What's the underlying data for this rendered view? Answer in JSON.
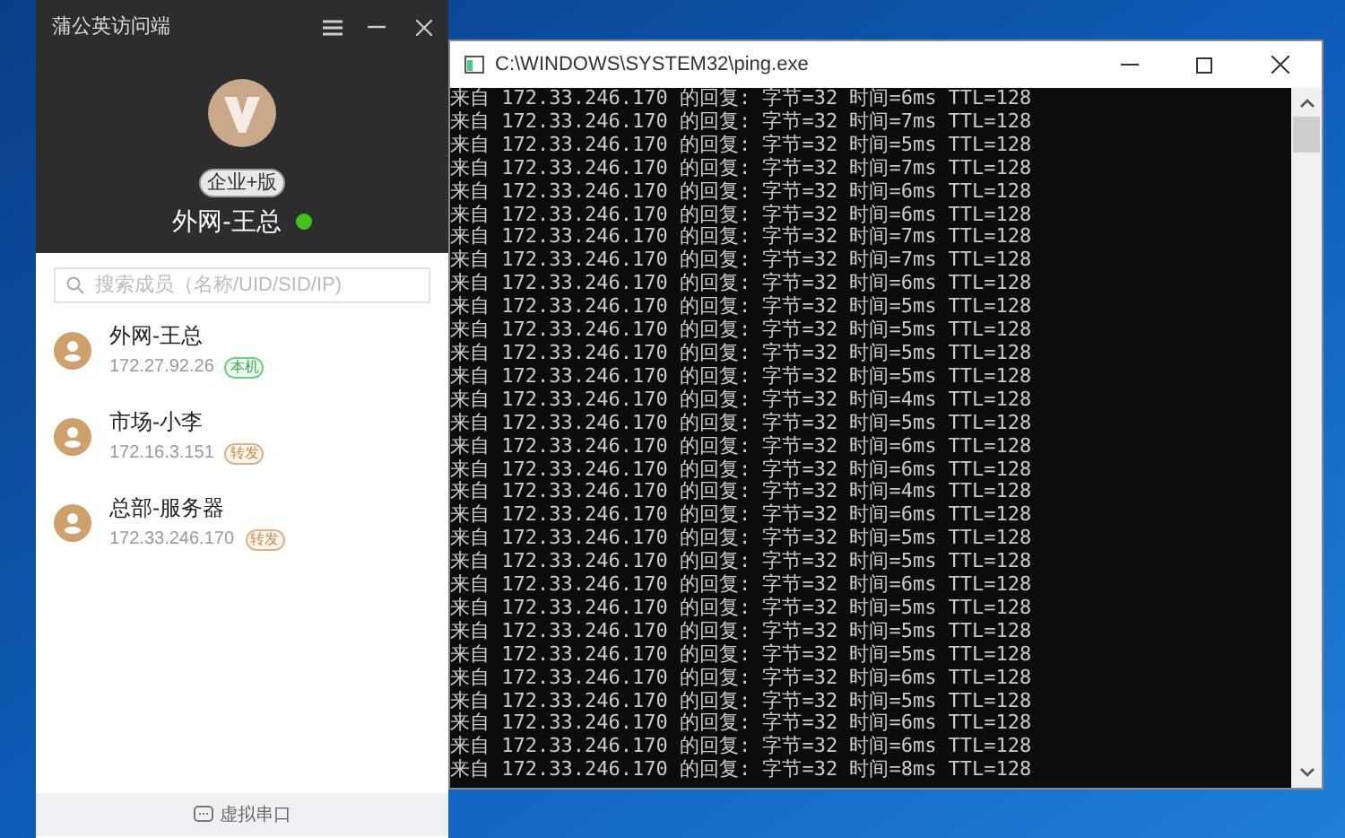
{
  "app": {
    "title": "蒲公英访问端",
    "edition": "企业+版",
    "user": "外网-王总",
    "online": true,
    "search": {
      "placeholder": "搜索成员（名称/UID/SID/IP)"
    },
    "members": [
      {
        "name": "外网-王总",
        "ip": "172.27.92.26",
        "tag": "本机",
        "kind": "local"
      },
      {
        "name": "市场-小李",
        "ip": "172.16.3.151",
        "tag": "转发",
        "kind": "relay"
      },
      {
        "name": "总部-服务器",
        "ip": "172.33.246.170",
        "tag": "转发",
        "kind": "relay"
      }
    ],
    "footer": "虚拟串口"
  },
  "console": {
    "title": "C:\\WINDOWS\\SYSTEM32\\ping.exe",
    "lines": [
      "来自 172.33.246.170 的回复: 字节=32 时间=6ms TTL=128",
      "来自 172.33.246.170 的回复: 字节=32 时间=7ms TTL=128",
      "来自 172.33.246.170 的回复: 字节=32 时间=5ms TTL=128",
      "来自 172.33.246.170 的回复: 字节=32 时间=7ms TTL=128",
      "来自 172.33.246.170 的回复: 字节=32 时间=6ms TTL=128",
      "来自 172.33.246.170 的回复: 字节=32 时间=6ms TTL=128",
      "来自 172.33.246.170 的回复: 字节=32 时间=7ms TTL=128",
      "来自 172.33.246.170 的回复: 字节=32 时间=7ms TTL=128",
      "来自 172.33.246.170 的回复: 字节=32 时间=6ms TTL=128",
      "来自 172.33.246.170 的回复: 字节=32 时间=5ms TTL=128",
      "来自 172.33.246.170 的回复: 字节=32 时间=5ms TTL=128",
      "来自 172.33.246.170 的回复: 字节=32 时间=5ms TTL=128",
      "来自 172.33.246.170 的回复: 字节=32 时间=5ms TTL=128",
      "来自 172.33.246.170 的回复: 字节=32 时间=4ms TTL=128",
      "来自 172.33.246.170 的回复: 字节=32 时间=5ms TTL=128",
      "来自 172.33.246.170 的回复: 字节=32 时间=6ms TTL=128",
      "来自 172.33.246.170 的回复: 字节=32 时间=6ms TTL=128",
      "来自 172.33.246.170 的回复: 字节=32 时间=4ms TTL=128",
      "来自 172.33.246.170 的回复: 字节=32 时间=6ms TTL=128",
      "来自 172.33.246.170 的回复: 字节=32 时间=5ms TTL=128",
      "来自 172.33.246.170 的回复: 字节=32 时间=5ms TTL=128",
      "来自 172.33.246.170 的回复: 字节=32 时间=6ms TTL=128",
      "来自 172.33.246.170 的回复: 字节=32 时间=5ms TTL=128",
      "来自 172.33.246.170 的回复: 字节=32 时间=5ms TTL=128",
      "来自 172.33.246.170 的回复: 字节=32 时间=5ms TTL=128",
      "来自 172.33.246.170 的回复: 字节=32 时间=6ms TTL=128",
      "来自 172.33.246.170 的回复: 字节=32 时间=5ms TTL=128",
      "来自 172.33.246.170 的回复: 字节=32 时间=6ms TTL=128",
      "来自 172.33.246.170 的回复: 字节=32 时间=6ms TTL=128",
      "来自 172.33.246.170 的回复: 字节=32 时间=8ms TTL=128"
    ]
  }
}
